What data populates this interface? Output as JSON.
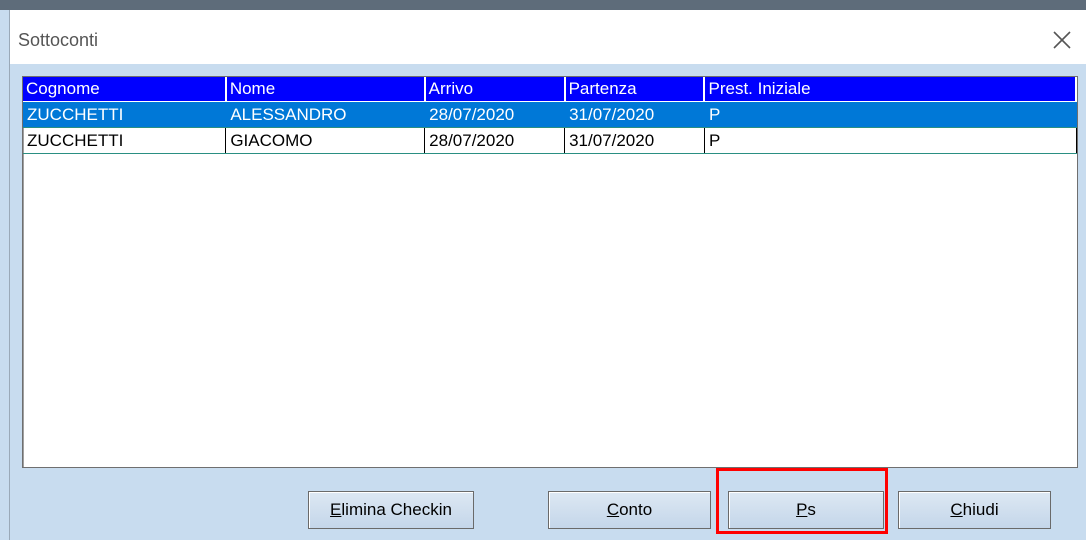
{
  "window": {
    "title": "Sottoconti"
  },
  "grid": {
    "columns": [
      "Cognome",
      "Nome",
      "Arrivo",
      "Partenza",
      "Prest. Iniziale"
    ],
    "rows": [
      [
        "ZUCCHETTI",
        "ALESSANDRO",
        "28/07/2020",
        "31/07/2020",
        "P"
      ],
      [
        "ZUCCHETTI",
        "GIACOMO",
        "28/07/2020",
        "31/07/2020",
        "P"
      ]
    ],
    "selected_row": 0
  },
  "buttons": {
    "elimina": {
      "mnemonic": "E",
      "rest": "limina Checkin"
    },
    "conto": {
      "mnemonic": "C",
      "rest": "onto"
    },
    "ps": {
      "mnemonic": "P",
      "rest": "s"
    },
    "chiudi": {
      "mnemonic": "C",
      "rest": "hiudi"
    }
  },
  "colors": {
    "header": "#0000ff",
    "selection": "#0078d7",
    "highlight": "#ff0000"
  }
}
